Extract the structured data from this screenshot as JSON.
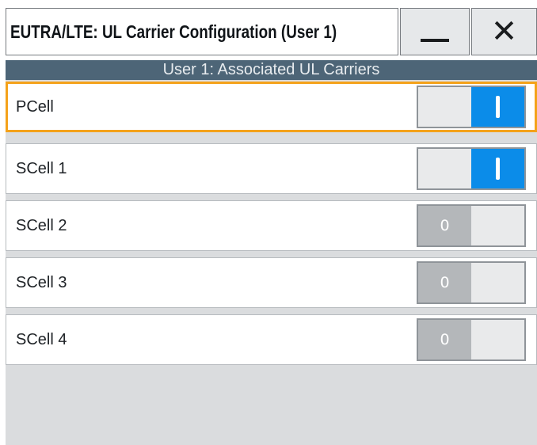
{
  "window": {
    "title": "EUTRA/LTE: UL Carrier Configuration (User 1)",
    "minimize_icon": "minimize-icon",
    "close_icon": "close-icon"
  },
  "section": {
    "header": "User 1: Associated UL Carriers"
  },
  "carriers": [
    {
      "label": "PCell",
      "state": "on",
      "state_text": "",
      "focused": true
    },
    {
      "label": "SCell 1",
      "state": "on",
      "state_text": ""
    },
    {
      "label": "SCell 2",
      "state": "off",
      "state_text": "0"
    },
    {
      "label": "SCell 3",
      "state": "off",
      "state_text": "0"
    },
    {
      "label": "SCell 4",
      "state": "off",
      "state_text": "0"
    }
  ],
  "colors": {
    "focus": "#f4a21a",
    "toggle_on": "#0b8ce9",
    "toggle_off": "#b4b7ba",
    "section_header": "#4d6577"
  }
}
